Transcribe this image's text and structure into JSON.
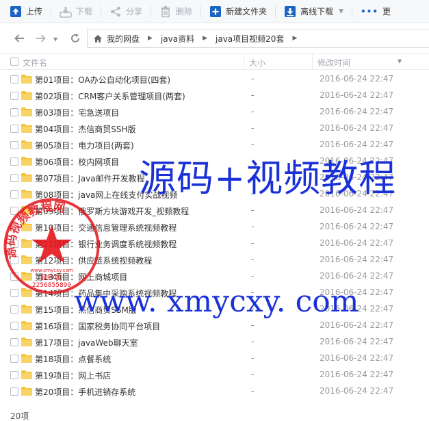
{
  "toolbar": {
    "upload": "上传",
    "download": "下载",
    "share": "分享",
    "delete": "删除",
    "new_folder": "新建文件夹",
    "offline_download": "离线下载",
    "more": "更"
  },
  "breadcrumb": [
    "我的网盘",
    "java资料",
    "java项目视频20套"
  ],
  "header": {
    "name": "文件名",
    "size": "大小",
    "modified": "修改时间"
  },
  "files": [
    {
      "name": "第01项目：OA办公自动化项目(四套)",
      "size": "-",
      "modified": "2016-06-24 22:47"
    },
    {
      "name": "第02项目：CRM客户关系管理项目(两套)",
      "size": "-",
      "modified": "2016-06-24 22:47"
    },
    {
      "name": "第03项目：宅急送项目",
      "size": "-",
      "modified": "2016-06-24 22:47"
    },
    {
      "name": "第04项目：杰信商贸SSH版",
      "size": "-",
      "modified": "2016-06-24 22:47"
    },
    {
      "name": "第05项目：电力项目(两套)",
      "size": "-",
      "modified": "2016-06-24 22:47"
    },
    {
      "name": "第06项目：校内网项目",
      "size": "-",
      "modified": "2016-06-24 22:47"
    },
    {
      "name": "第07项目：Java邮件开发教程",
      "size": "-",
      "modified": "2016-06-24 22:47"
    },
    {
      "name": "第08项目：java网上在线支付实战视频",
      "size": "-",
      "modified": "2016-06-24 22:47"
    },
    {
      "name": "第09项目：俄罗斯方块游戏开发_视频教程",
      "size": "-",
      "modified": "2016-06-24 22:47"
    },
    {
      "name": "第10项目：交通信息管理系统视频教程",
      "size": "-",
      "modified": "2016-06-24 22:47"
    },
    {
      "name": "第11项目：银行业务调度系统视频教程",
      "size": "-",
      "modified": "2016-06-24 22:47"
    },
    {
      "name": "第12项目：供应链系统视频教程",
      "size": "-",
      "modified": "2016-06-24 22:47"
    },
    {
      "name": "第13项目：网上商城项目",
      "size": "-",
      "modified": "2016-06-24 22:47"
    },
    {
      "name": "第14项目：药品集中采购系统视频教程",
      "size": "-",
      "modified": "2016-06-24 22:47"
    },
    {
      "name": "第15项目：杰信商贸SSM版",
      "size": "-",
      "modified": "2016-06-24 22:47"
    },
    {
      "name": "第16项目：国家税务协同平台项目",
      "size": "-",
      "modified": "2016-06-24 22:47"
    },
    {
      "name": "第17项目：javaWeb聊天室",
      "size": "-",
      "modified": "2016-06-24 22:47"
    },
    {
      "name": "第18项目：点餐系统",
      "size": "-",
      "modified": "2016-06-24 22:47"
    },
    {
      "name": "第19项目：网上书店",
      "size": "-",
      "modified": "2016-06-24 22:47"
    },
    {
      "name": "第20项目：手机进销存系统",
      "size": "-",
      "modified": "2016-06-24 22:47"
    }
  ],
  "footer": "20项",
  "watermark": {
    "headline": "源码+视频教程",
    "url": "www. xmycxy. com",
    "seal_text": "源码视频教程网",
    "seal_small": "www.xmycxy.com",
    "seal_service": "服务QQ",
    "seal_number": "2256855899"
  },
  "colors": {
    "accent": "#1a65c4",
    "folder": "#f6c53c",
    "watermark_blue": "#1a31d8",
    "seal_red": "#e3141b"
  }
}
